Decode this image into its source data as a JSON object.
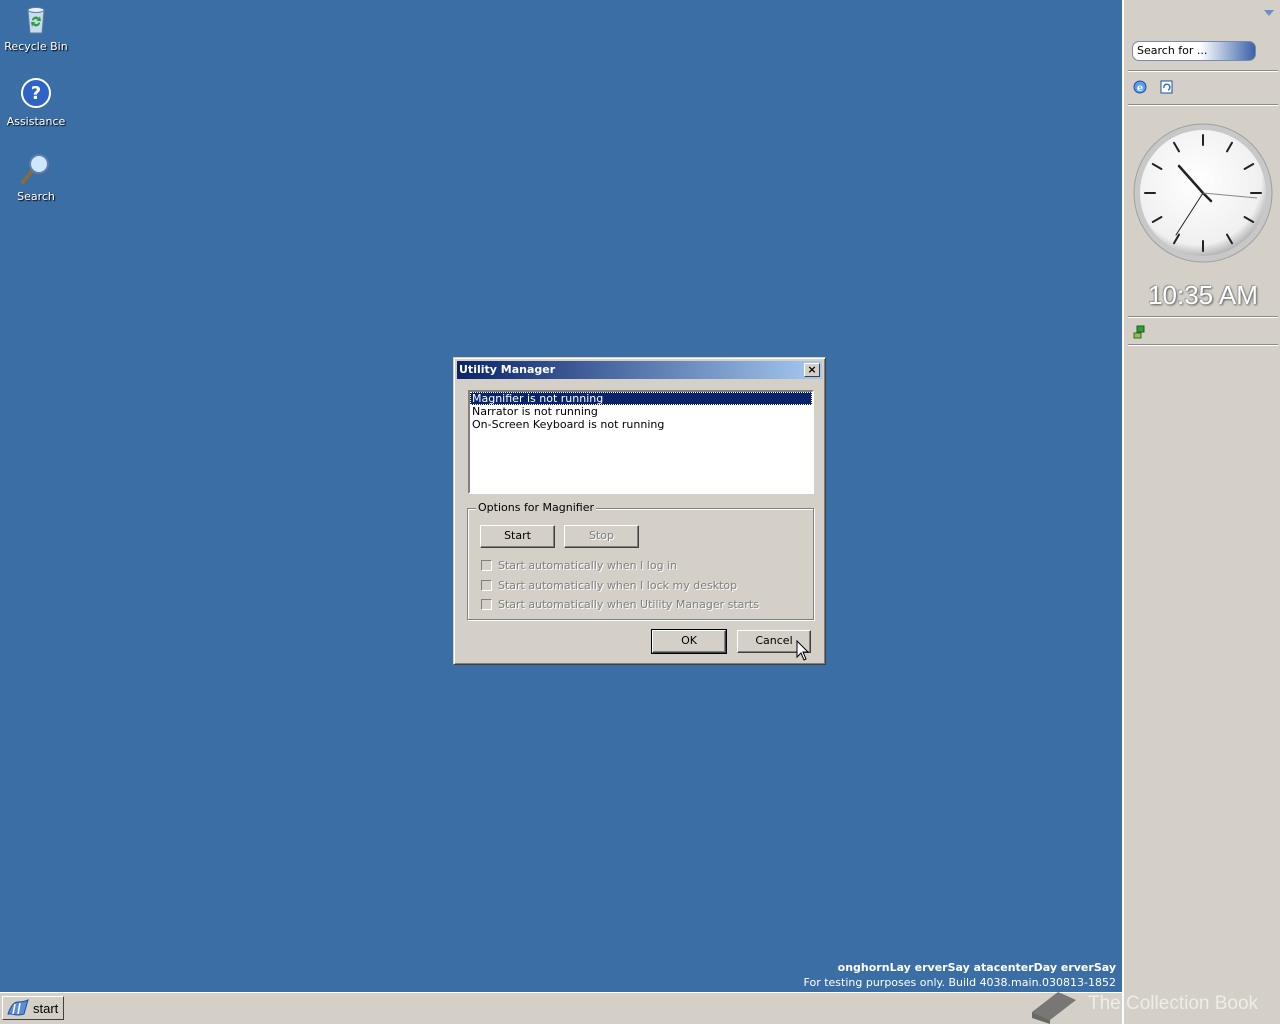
{
  "desktop": {
    "icons": [
      {
        "label": "Recycle Bin",
        "icon": "recycle-bin-icon"
      },
      {
        "label": "Assistance",
        "icon": "help-icon"
      },
      {
        "label": "Search",
        "icon": "search-icon"
      }
    ]
  },
  "sidebar": {
    "search_placeholder": "Search for ...",
    "clock_time": "10:35 AM"
  },
  "dialog": {
    "title": "Utility Manager",
    "close_label": "×",
    "list_items": [
      "Magnifier is not running",
      "Narrator is not running",
      "On-Screen Keyboard is not running"
    ],
    "group_label": "Options for Magnifier",
    "start_label": "Start",
    "stop_label": "Stop",
    "checkbox_login": "Start automatically when I log in",
    "checkbox_lock": "Start automatically when I lock my desktop",
    "checkbox_utilman": "Start automatically when Utility Manager starts",
    "ok_label": "OK",
    "cancel_label": "Cancel"
  },
  "taskbar": {
    "start_label": "start"
  },
  "build_info": {
    "line1": "onghornLay erverSay atacenterDay erverSay",
    "line2": "For testing purposes only. Build 4038.main.030813-1852"
  },
  "watermark": {
    "text": "The Collection Book"
  },
  "colors": {
    "desktop": "#3a6ea5",
    "titlebar_start": "#0a246a",
    "titlebar_end": "#a6caf0",
    "face": "#d4d0c8"
  }
}
